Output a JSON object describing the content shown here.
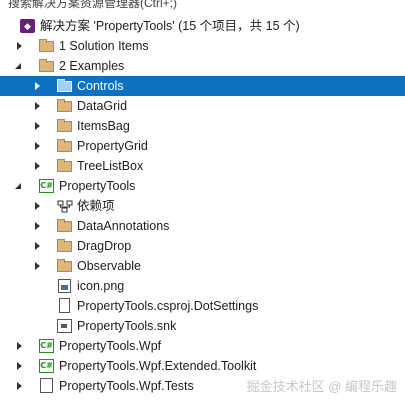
{
  "search": {
    "placeholder": "搜索解决方案资源管理器(Ctrl+;)"
  },
  "tree": {
    "solution_label": "解决方案 'PropertyTools' (15 个项目，共 15 个)",
    "items": [
      {
        "label": "1 Solution Items",
        "icon": "folder-icon"
      },
      {
        "label": "2 Examples",
        "icon": "folder-icon"
      },
      {
        "label": "Controls",
        "icon": "folder-icon"
      },
      {
        "label": "DataGrid",
        "icon": "folder-icon"
      },
      {
        "label": "ItemsBag",
        "icon": "folder-icon"
      },
      {
        "label": "PropertyGrid",
        "icon": "folder-icon"
      },
      {
        "label": "TreeListBox",
        "icon": "folder-icon"
      },
      {
        "label": "PropertyTools",
        "icon": "csharp-project-icon"
      },
      {
        "label": "依赖项",
        "icon": "dependencies-icon"
      },
      {
        "label": "DataAnnotations",
        "icon": "folder-icon"
      },
      {
        "label": "DragDrop",
        "icon": "folder-icon"
      },
      {
        "label": "Observable",
        "icon": "folder-icon"
      },
      {
        "label": "icon.png",
        "icon": "image-file-icon"
      },
      {
        "label": "PropertyTools.csproj.DotSettings",
        "icon": "file-icon"
      },
      {
        "label": "PropertyTools.snk",
        "icon": "key-file-icon"
      },
      {
        "label": "PropertyTools.Wpf",
        "icon": "csharp-project-icon"
      },
      {
        "label": "PropertyTools.Wpf.Extended.Toolkit",
        "icon": "csharp-project-icon"
      },
      {
        "label": "PropertyTools.Wpf.Tests",
        "icon": "test-project-icon"
      }
    ]
  },
  "watermark": "掘金技术社区 @ 编程乐趣",
  "colors": {
    "selection": "#0e70c0",
    "folder": "#dcb67a",
    "solution": "#68217a",
    "project": "#2c8a2c"
  }
}
